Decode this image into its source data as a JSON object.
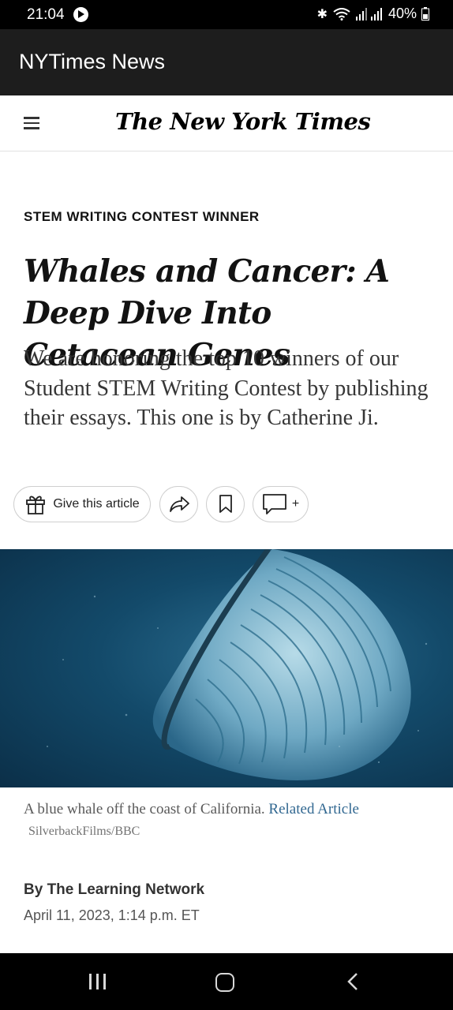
{
  "status_bar": {
    "time": "21:04",
    "battery": "40%",
    "icons": [
      "bluetooth-icon",
      "wifi-icon",
      "signal-icon",
      "battery-icon"
    ]
  },
  "app_bar": {
    "title": "NYTimes News"
  },
  "header": {
    "logo": "The New York Times"
  },
  "article": {
    "kicker": "STEM WRITING CONTEST WINNER",
    "headline": "Whales and Cancer: A Deep Dive Into Cetacean Genes",
    "summary": "We are honoring the top 10 winners of our Student STEM Writing Contest by publishing their essays. This one is by Catherine Ji.",
    "actions": {
      "gift_label": "Give this article",
      "comment_plus": "+"
    },
    "image": {
      "caption": "A blue whale off the coast of California.",
      "related_link": "Related Article",
      "credit": "SilverbackFilms/BBC"
    },
    "byline": "By The Learning Network",
    "date": "April 11, 2023, 1:14 p.m. ET"
  },
  "colors": {
    "app_bar_bg": "#1d1d1d",
    "link": "#326891",
    "text": "#121212"
  }
}
